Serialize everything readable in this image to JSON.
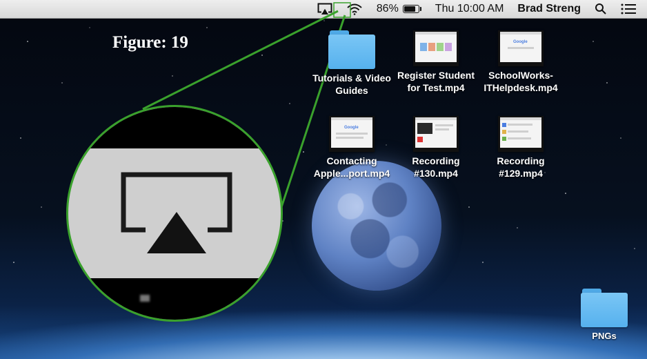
{
  "menubar": {
    "battery_percent": "86%",
    "battery_level": 0.86,
    "clock": "Thu 10:00 AM",
    "user_name": "Brad Streng",
    "icons": [
      "airplay-icon",
      "wifi-icon",
      "battery-icon",
      "spotlight-search-icon",
      "notification-center-icon"
    ]
  },
  "figure_label": "Figure: 19",
  "desktop_items": [
    {
      "label": "Tutorials & Video Guides",
      "kind": "folder"
    },
    {
      "label": "Register Student for Test.mp4",
      "kind": "video"
    },
    {
      "label": "SchoolWorks-ITHelpdesk.mp4",
      "kind": "video"
    },
    {
      "label": "Contacting Apple...port.mp4",
      "kind": "video"
    },
    {
      "label": "Recording #130.mp4",
      "kind": "video"
    },
    {
      "label": "Recording #129.mp4",
      "kind": "video"
    },
    {
      "label": "PNGs",
      "kind": "folder"
    }
  ],
  "colors": {
    "highlight_green": "#3aa12c",
    "folder_blue": "#5cb4ef",
    "menubar_bg": "#e4e4e4"
  }
}
